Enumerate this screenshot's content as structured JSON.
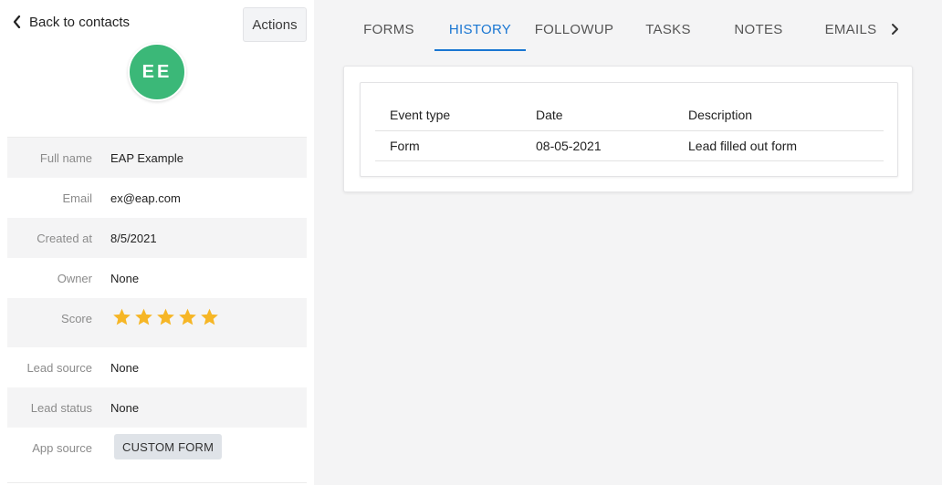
{
  "back": {
    "label": "Back to contacts",
    "icon": "chevron-left-icon"
  },
  "actions": {
    "label": "Actions"
  },
  "avatar": {
    "initials": "EE",
    "color": "#3bb878"
  },
  "details": [
    {
      "label": "Full name",
      "value": "EAP Example"
    },
    {
      "label": "Email",
      "value": "ex@eap.com"
    },
    {
      "label": "Created at",
      "value": "8/5/2021"
    },
    {
      "label": "Owner",
      "value": "None"
    },
    {
      "label": "Score",
      "rating": 5,
      "max": 5
    },
    {
      "label": "Lead source",
      "value": "None"
    },
    {
      "label": "Lead status",
      "value": "None"
    },
    {
      "label": "App source",
      "value": "CUSTOM FORM"
    }
  ],
  "tabs": [
    {
      "label": "FORMS",
      "active": false
    },
    {
      "label": "HISTORY",
      "active": true
    },
    {
      "label": "FOLLOWUP",
      "active": false
    },
    {
      "label": "TASKS",
      "active": false
    },
    {
      "label": "NOTES",
      "active": false
    },
    {
      "label": "EMAILS",
      "active": false
    }
  ],
  "history": {
    "columns": [
      "Event type",
      "Date",
      "Description"
    ],
    "rows": [
      [
        "Form",
        "08-05-2021",
        "Lead filled out form"
      ]
    ]
  },
  "colors": {
    "accent": "#1976d2",
    "star": "#f6b626",
    "avatar": "#3bb878"
  }
}
